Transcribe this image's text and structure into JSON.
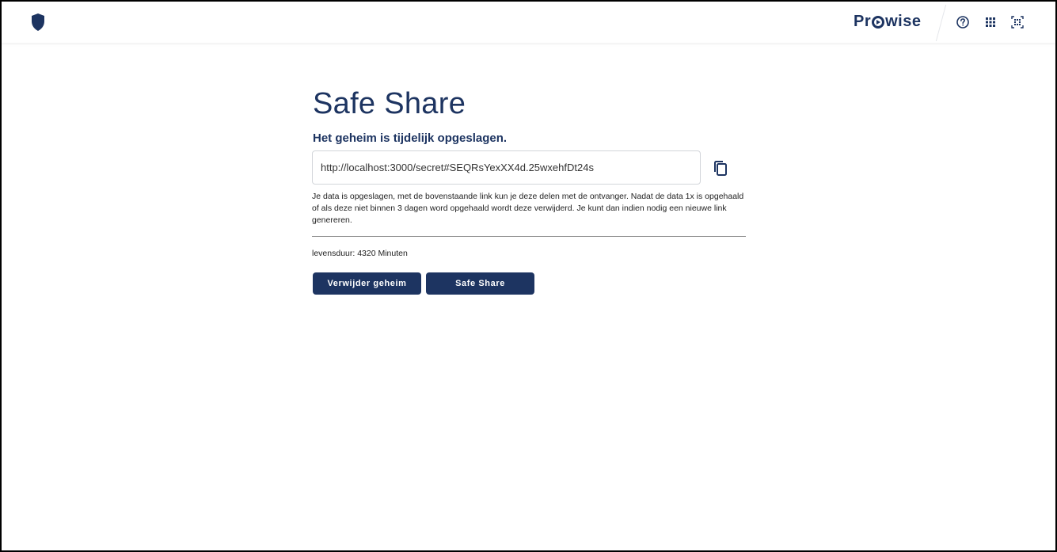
{
  "header": {
    "brand": "Prowise",
    "brand_prefix": "Pr",
    "brand_suffix": "wise",
    "icons": [
      "shield-icon",
      "help-circle-icon",
      "apps-grid-icon",
      "qr-code-icon"
    ],
    "accent_color": "#1d3461"
  },
  "main": {
    "title": "Safe Share",
    "subtitle": "Het geheim is tijdelijk opgeslagen.",
    "secret_url": "http://localhost:3000/secret#SEQRsYexXX4d.25wxehfDt24s",
    "description": "Je data is opgeslagen, met de bovenstaande link kun je deze delen met de ontvanger. Nadat de data 1x is opgehaald of als deze niet binnen 3 dagen word opgehaald wordt deze verwijderd. Je kunt dan indien nodig een nieuwe link genereren.",
    "lifetime": "levensduur: 4320 Minuten",
    "buttons": {
      "delete": "Verwijder geheim",
      "safe_share": "Safe Share"
    }
  }
}
